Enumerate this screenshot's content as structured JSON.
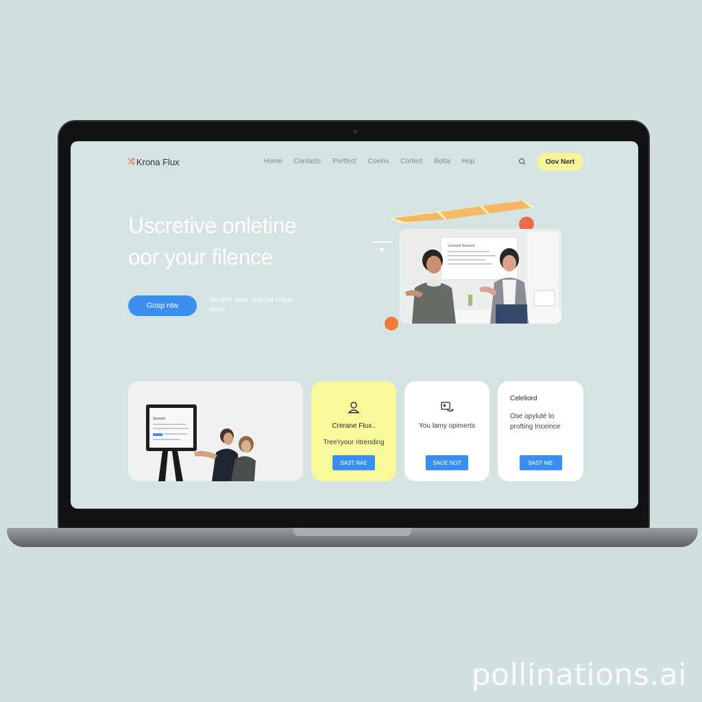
{
  "nav": {
    "logo": "Krona Flux",
    "links": [
      "Home",
      "Contacts",
      "Portfect",
      "Covins",
      "Cortect",
      "Botta",
      "Hop"
    ],
    "cta": "Oov Nert"
  },
  "hero": {
    "title_line1": "Uscretive onletine",
    "title_line2": "oor your filence",
    "button": "Gosp ntw",
    "subtext": "On teer swet. Izgictol onlyer serre."
  },
  "cards": [
    {
      "title": "Crerane Flux..",
      "text": "Tree'ryour ritrending",
      "button": "SAST NAE"
    },
    {
      "title": "",
      "text": "You lamy opimerts",
      "button": "SAGE NOT"
    },
    {
      "title": "Celeliord",
      "text": "Ose opyluté to profting Inceince",
      "button": "SAST NIE"
    }
  ],
  "photo_card_screen": "Sunwed",
  "hero_photo_board": "Scerwed Noteved",
  "watermark": "pollinations.ai",
  "colors": {
    "accent_blue": "#3a8ff0",
    "accent_yellow": "#f8f99a",
    "screen_bg": "#d6e3e3",
    "page_bg": "#d3e0e1"
  },
  "icons": [
    "search-icon",
    "user-icon",
    "device-link-icon"
  ]
}
